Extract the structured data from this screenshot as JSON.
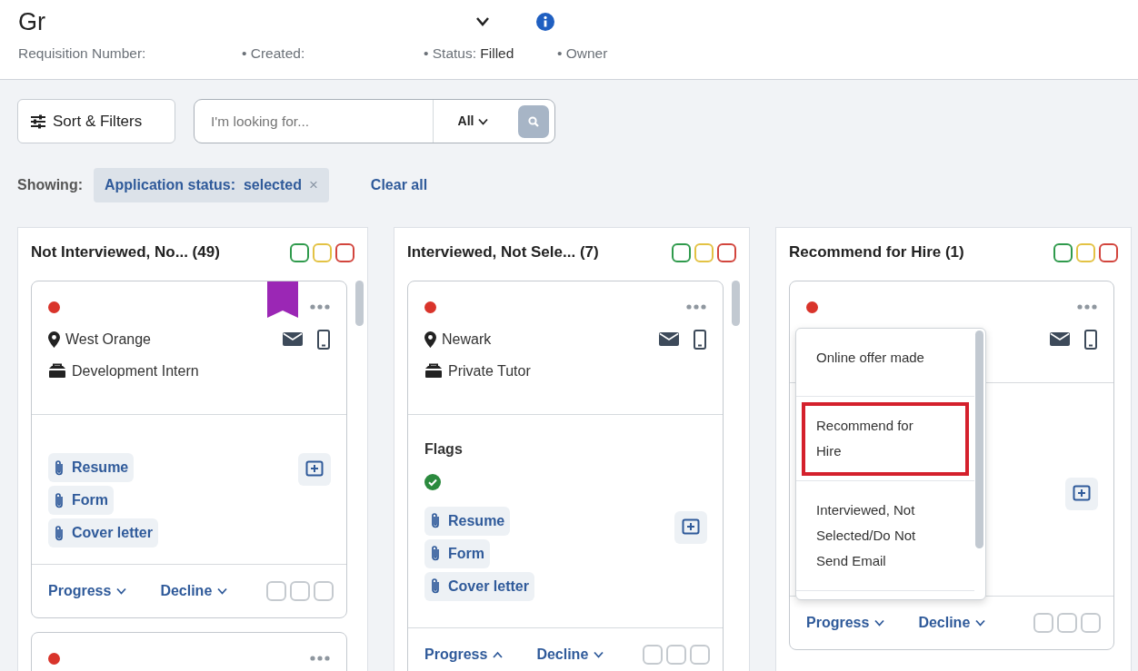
{
  "header": {
    "title": "Gr",
    "meta": [
      {
        "label": "Requisition Number:"
      },
      {
        "label": "• Created:"
      },
      {
        "label": "• Status:",
        "value": "Filled"
      },
      {
        "label": "• Owner"
      }
    ]
  },
  "toolbar": {
    "sort_button": "Sort & Filters",
    "search": {
      "placeholder": "I'm looking for...",
      "scope": "All"
    }
  },
  "filters": {
    "label": "Showing:",
    "chips": [
      {
        "text": "Application status:  selected",
        "close": "×"
      }
    ],
    "clear": "Clear all"
  },
  "columns": [
    {
      "title": "Not Interviewed, No...",
      "count": "(49)",
      "color_filters": [
        {
          "color": "#2f9a4c"
        },
        {
          "color": "#e3c244"
        },
        {
          "color": "#d2453d"
        }
      ],
      "scrollbar": true,
      "cards": [
        {
          "color": "#d9342b",
          "bookmarked": true,
          "contact_icons": true,
          "location": "West Orange",
          "job": "Development Intern",
          "add_note": true,
          "attachments": [
            "Resume",
            "Form",
            "Cover letter"
          ],
          "progress": {
            "label": "Progress",
            "expanded": false
          },
          "decline": {
            "label": "Decline",
            "expanded": false
          },
          "boxes": [
            {
              "checked": false
            },
            {
              "checked": false
            },
            {
              "checked": false
            }
          ]
        },
        {
          "color": "#d9342b",
          "bookmarked": false
        }
      ]
    },
    {
      "title": "Interviewed, Not Sele...",
      "count": "(7)",
      "color_filters": [
        {
          "color": "#2f9a4c"
        },
        {
          "color": "#e3c244"
        },
        {
          "color": "#d2453d"
        }
      ],
      "scrollbar": true,
      "cards": [
        {
          "color": "#d9342b",
          "bookmarked": false,
          "contact_icons": true,
          "location": "Newark",
          "job": "Private Tutor",
          "flags_title": "Flags",
          "flag_ok": true,
          "add_note": true,
          "attachments": [
            "Resume",
            "Form",
            "Cover letter"
          ],
          "progress": {
            "label": "Progress",
            "expanded": true
          },
          "decline": {
            "label": "Decline",
            "expanded": false
          },
          "boxes": [
            {
              "checked": false
            },
            {
              "checked": false
            },
            {
              "checked": false
            }
          ]
        }
      ]
    },
    {
      "title": "Recommend for Hire",
      "count": "(1)",
      "color_filters": [
        {
          "color": "#2f9a4c"
        },
        {
          "color": "#e3c244"
        },
        {
          "color": "#d2453d"
        }
      ],
      "scrollbar": false,
      "cards": [
        {
          "color": "#d9342b",
          "bookmarked": false,
          "contact_icons": true,
          "add_note": true,
          "progress": {
            "label": "Progress",
            "expanded": false
          },
          "decline": {
            "label": "Decline",
            "expanded": false
          },
          "boxes": [
            {
              "checked": false
            },
            {
              "checked": false
            },
            {
              "checked": false
            }
          ],
          "menu": {
            "items": [
              {
                "text": "Online offer made",
                "highlighted": false
              },
              {
                "text": "Recommend for Hire",
                "highlighted": true
              },
              {
                "text": "Interviewed, Not Selected/Do Not Send Email",
                "highlighted": false
              }
            ]
          }
        }
      ]
    }
  ]
}
